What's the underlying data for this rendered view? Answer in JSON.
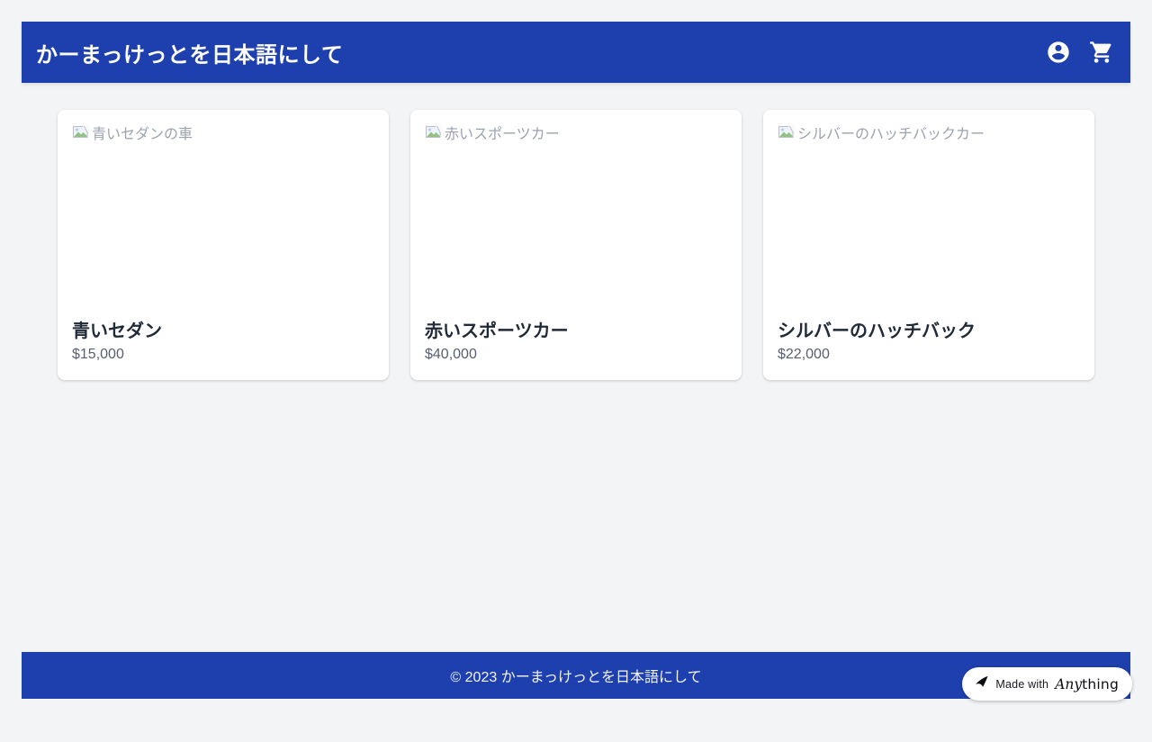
{
  "header": {
    "title": "かーまっけっとを日本語にして",
    "icons": [
      {
        "name": "account-circle-icon"
      },
      {
        "name": "shopping-cart-icon"
      }
    ]
  },
  "products": [
    {
      "image_alt": "青いセダンの車",
      "name": "青いセダン",
      "price": "$15,000"
    },
    {
      "image_alt": "赤いスポーツカー",
      "name": "赤いスポーツカー",
      "price": "$40,000"
    },
    {
      "image_alt": "シルバーのハッチバックカー",
      "name": "シルバーのハッチバック",
      "price": "$22,000"
    }
  ],
  "footer": {
    "copyright": "© 2023 かーまっけっとを日本語にして"
  },
  "badge": {
    "made_with": "Made with",
    "brand_italic": "Any",
    "brand_rest": "thing",
    "logo": "anything-logo-icon"
  },
  "colors": {
    "primary_blue": "#1e40af",
    "page_background": "#f3f4f6",
    "card_background": "#ffffff",
    "product_name_text": "#1f2937",
    "price_text": "#57606f",
    "alt_text": "#9ca3af",
    "header_text": "#ffffff"
  }
}
